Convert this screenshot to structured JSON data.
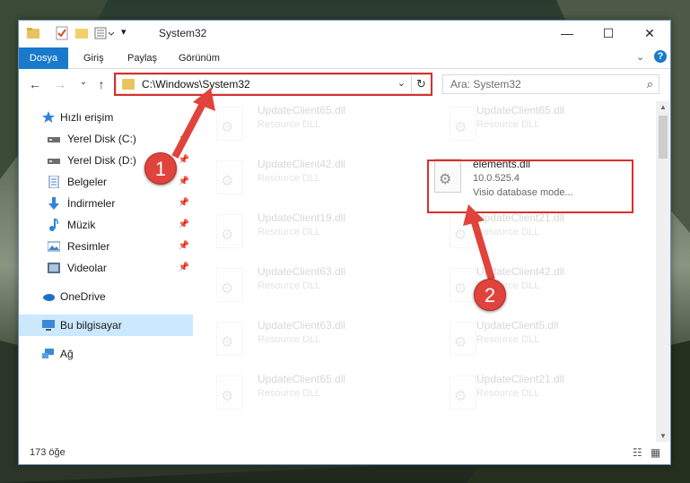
{
  "window": {
    "title": "System32",
    "minimize": "—",
    "maximize": "☐",
    "close": "✕"
  },
  "ribbon": {
    "tabs": [
      "Dosya",
      "Giriş",
      "Paylaş",
      "Görünüm"
    ],
    "expand_glyph": "⌄",
    "help_glyph": "?"
  },
  "nav": {
    "back": "←",
    "forward": "→",
    "recent": "⌄",
    "up": "↑"
  },
  "address": {
    "path": "C:\\Windows\\System32",
    "dropdown": "⌄",
    "refresh": "↻"
  },
  "search": {
    "placeholder": "Ara: System32",
    "icon": "⌕"
  },
  "sidebar": {
    "items": [
      {
        "label": "Hızlı erişim",
        "icon": "star-icon"
      },
      {
        "label": "Yerel Disk (C:)",
        "icon": "drive-icon",
        "pin": "📌"
      },
      {
        "label": "Yerel Disk (D:)",
        "icon": "drive-icon",
        "pin": "📌"
      },
      {
        "label": "Belgeler",
        "icon": "documents-icon",
        "pin": "📌"
      },
      {
        "label": "İndirmeler",
        "icon": "download-icon",
        "pin": "📌"
      },
      {
        "label": "Müzik",
        "icon": "music-icon",
        "pin": "📌"
      },
      {
        "label": "Resimler",
        "icon": "pictures-icon",
        "pin": "📌"
      },
      {
        "label": "Videolar",
        "icon": "videos-icon",
        "pin": "📌"
      },
      {
        "label": "OneDrive",
        "icon": "cloud-icon"
      },
      {
        "label": "Bu bilgisayar",
        "icon": "computer-icon"
      },
      {
        "label": "Ağ",
        "icon": "network-icon"
      }
    ]
  },
  "files": {
    "left": [
      {
        "name": "UpdateClient65.dll",
        "type": "Resource DLL"
      },
      {
        "name": "UpdateClient42.dll",
        "type": "Resource DLL"
      },
      {
        "name": "UpdateClient19.dll",
        "type": "Resource DLL"
      },
      {
        "name": "UpdateClient63.dll",
        "type": "Resource DLL"
      },
      {
        "name": "UpdateClient63.dll",
        "type": "Resource DLL"
      },
      {
        "name": "UpdateClient65.dll",
        "type": "Resource DLL"
      }
    ],
    "right": [
      {
        "name": "UpdateClient65.dll",
        "type": "Resource DLL"
      },
      {
        "name": "elements.dll",
        "version": "10.0.525.4",
        "type": "Visio database mode..."
      },
      {
        "name": "UpdateClient21.dll",
        "type": "Resource DLL"
      },
      {
        "name": "UpdateClient42.dll",
        "type": "Resource DLL"
      },
      {
        "name": "UpdateClient5.dll",
        "type": "Resource DLL"
      },
      {
        "name": "UpdateClient21.dll",
        "type": "Resource DLL"
      }
    ]
  },
  "status": {
    "count": "173 öğe"
  },
  "annotations": {
    "step1": "1",
    "step2": "2",
    "color": "#e0433b"
  }
}
